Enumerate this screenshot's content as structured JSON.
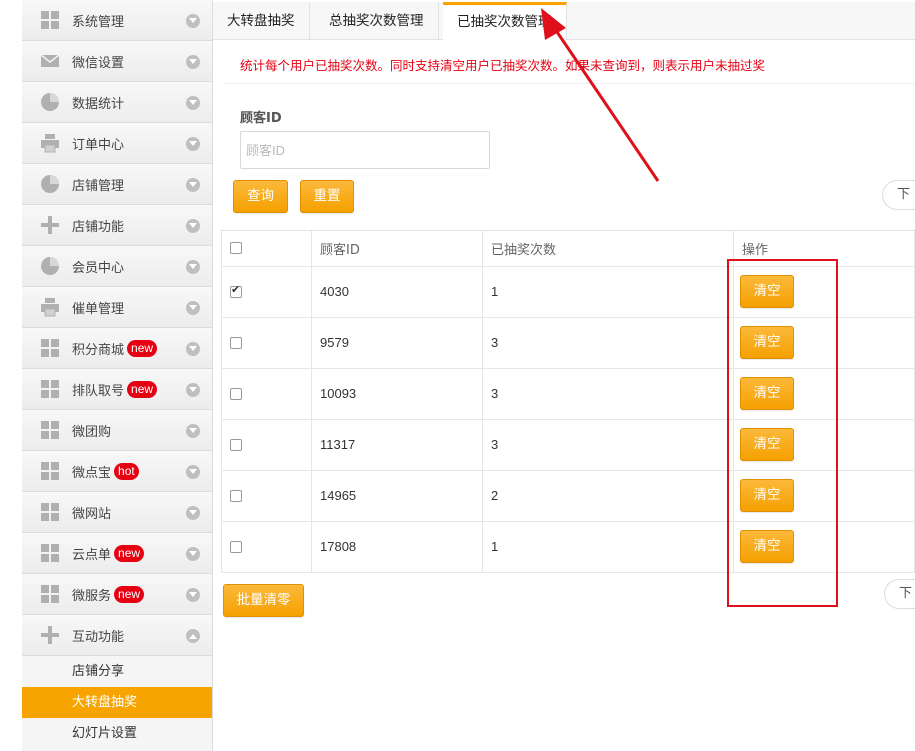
{
  "sidebar": {
    "items": [
      {
        "label": "系统管理",
        "icon": "grid-icon",
        "badge": ""
      },
      {
        "label": "微信设置",
        "icon": "envelope-icon",
        "badge": ""
      },
      {
        "label": "数据统计",
        "icon": "pie-chart-icon",
        "badge": ""
      },
      {
        "label": "订单中心",
        "icon": "printer-icon",
        "badge": ""
      },
      {
        "label": "店铺管理",
        "icon": "pie-chart-icon",
        "badge": ""
      },
      {
        "label": "店铺功能",
        "icon": "plus-icon",
        "badge": ""
      },
      {
        "label": "会员中心",
        "icon": "pie-chart-icon",
        "badge": ""
      },
      {
        "label": "催单管理",
        "icon": "printer-icon",
        "badge": ""
      },
      {
        "label": "积分商城",
        "icon": "grid-icon",
        "badge": "new"
      },
      {
        "label": "排队取号",
        "icon": "grid-icon",
        "badge": "new"
      },
      {
        "label": "微团购",
        "icon": "grid-icon",
        "badge": ""
      },
      {
        "label": "微点宝",
        "icon": "grid-icon",
        "badge": "hot"
      },
      {
        "label": "微网站",
        "icon": "grid-icon",
        "badge": ""
      },
      {
        "label": "云点单",
        "icon": "grid-icon",
        "badge": "new"
      },
      {
        "label": "微服务",
        "icon": "grid-icon",
        "badge": "new"
      },
      {
        "label": "互动功能",
        "icon": "plus-icon",
        "badge": ""
      }
    ],
    "sub_items": [
      {
        "label": "店铺分享",
        "active": false
      },
      {
        "label": "大转盘抽奖",
        "active": true
      },
      {
        "label": "幻灯片设置",
        "active": false
      }
    ]
  },
  "tabs": [
    {
      "label": "大转盘抽奖",
      "active": false
    },
    {
      "label": "总抽奖次数管理",
      "active": false
    },
    {
      "label": "已抽奖次数管理",
      "active": true
    }
  ],
  "notice": "统计每个用户已抽奖次数。同时支持清空用户已抽奖次数。如果未查询到，则表示用户未抽过奖",
  "search": {
    "label": "顾客ID",
    "placeholder": "顾客ID",
    "query_label": "查询",
    "reset_label": "重置"
  },
  "pagination": {
    "next_label": "下一"
  },
  "table": {
    "headers": [
      "",
      "顾客ID",
      "已抽奖次数",
      "操作"
    ],
    "rows": [
      {
        "checked": true,
        "customer_id": "4030",
        "count": "1",
        "action": "清空"
      },
      {
        "checked": false,
        "customer_id": "9579",
        "count": "3",
        "action": "清空"
      },
      {
        "checked": false,
        "customer_id": "10093",
        "count": "3",
        "action": "清空"
      },
      {
        "checked": false,
        "customer_id": "11317",
        "count": "3",
        "action": "清空"
      },
      {
        "checked": false,
        "customer_id": "14965",
        "count": "2",
        "action": "清空"
      },
      {
        "checked": false,
        "customer_id": "17808",
        "count": "1",
        "action": "清空"
      }
    ]
  },
  "batch_clear_label": "批量清零",
  "colors": {
    "accent": "#f7a400",
    "notice": "#e60012",
    "annotation": "#e0101a"
  }
}
